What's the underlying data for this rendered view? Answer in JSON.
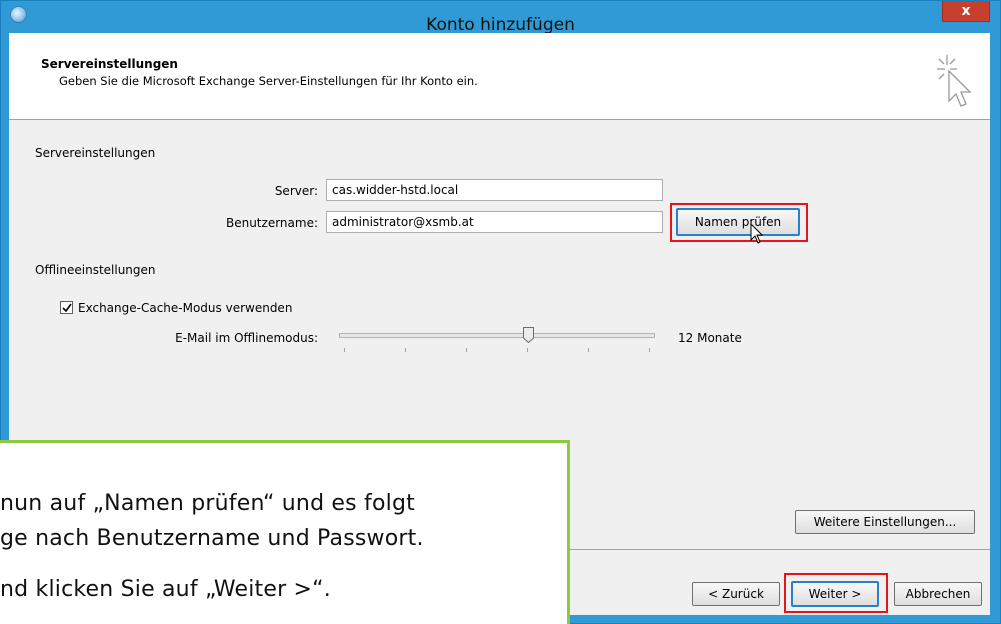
{
  "window": {
    "title": "Konto hinzufügen",
    "close_label": "x"
  },
  "header": {
    "title": "Servereinstellungen",
    "subtitle": "Geben Sie die Microsoft Exchange Server-Einstellungen für Ihr Konto ein."
  },
  "server_section": {
    "heading": "Servereinstellungen",
    "server_label": "Server:",
    "server_value": "cas.widder-hstd.local",
    "username_label": "Benutzername:",
    "username_value": "administrator@xsmb.at",
    "check_names_button": "Namen prüfen"
  },
  "offline_section": {
    "heading": "Offlineeinstellungen",
    "cache_mode_label": "Exchange-Cache-Modus verwenden",
    "cache_mode_checked": true,
    "offline_mail_label": "E-Mail im Offlinemodus:",
    "offline_mail_value": "12 Monate",
    "slider_position": 0.6
  },
  "buttons": {
    "more_settings": "Weitere Einstellungen...",
    "back": "< Zurück",
    "next": "Weiter >",
    "cancel": "Abbrechen"
  },
  "callout": {
    "line1": " nun auf „Namen prüfen“ und es folgt",
    "line2": "ge nach Benutzername und Passwort.",
    "line3": "nd klicken Sie auf  „Weiter >“."
  },
  "colors": {
    "window_frame": "#2f9ad6",
    "close_button": "#c7402e",
    "highlight_box": "#e3161c",
    "callout_border": "#8dc83d"
  }
}
